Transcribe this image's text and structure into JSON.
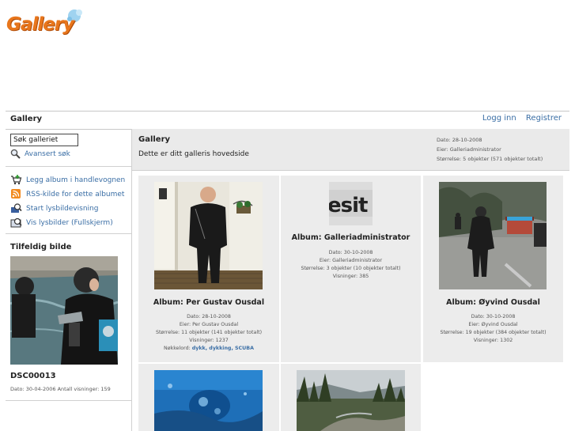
{
  "logo": {
    "text": "Gallery"
  },
  "topbar": {
    "title": "Gallery",
    "login": "Logg inn",
    "register": "Registrer"
  },
  "sidebar": {
    "search_value": "Søk galleriet",
    "advanced_search": "Avansert søk",
    "actions": [
      {
        "label": "Legg album i handlevognen",
        "icon": "cart-add-icon"
      },
      {
        "label": "RSS-kilde for dette albumet",
        "icon": "rss-icon"
      },
      {
        "label": "Start lysbildevisning",
        "icon": "slideshow-icon"
      },
      {
        "label": "Vis lysbilder (Fullskjerm)",
        "icon": "slideshow-fullscreen-icon"
      }
    ],
    "random": {
      "title": "Tilfeldig bilde",
      "name": "DSC00013",
      "meta": "Dato: 30-04-2006 Antall visninger: 159"
    }
  },
  "header": {
    "title": "Gallery",
    "description": "Dette er ditt galleris hovedside",
    "date": "Dato: 28-10-2008",
    "owner": "Eier: Galleriadministrator",
    "size": "Størrelse: 5 objekter (571 objekter totalt)"
  },
  "albums": [
    {
      "title": "Album: Per Gustav Ousdal",
      "date": "Dato: 28-10-2008",
      "owner": "Eier: Per Gustav Ousdal",
      "size": "Størrelse: 11 objekter (141 objekter totalt)",
      "views": "Visninger: 1237",
      "keywords_label": "Nøkkelord:",
      "keywords": "dykk, dykking, SCUBA"
    },
    {
      "title": "Album: Galleriadministrator",
      "thumb_text": "esit",
      "date": "Dato: 30-10-2008",
      "owner": "Eier: Galleriadministrator",
      "size": "Størrelse: 3 objekter (10 objekter totalt)",
      "views": "Visninger: 385"
    },
    {
      "title": "Album: Øyvind Ousdal",
      "date": "Dato: 30-10-2008",
      "owner": "Eier: Øyvind Ousdal",
      "size": "Størrelse: 19 objekter (384 objekter totalt)",
      "views": "Visninger: 1302"
    }
  ],
  "colors": {
    "link": "#3a6ea5",
    "band": "#eaeaea",
    "logo": "#e8761c"
  }
}
